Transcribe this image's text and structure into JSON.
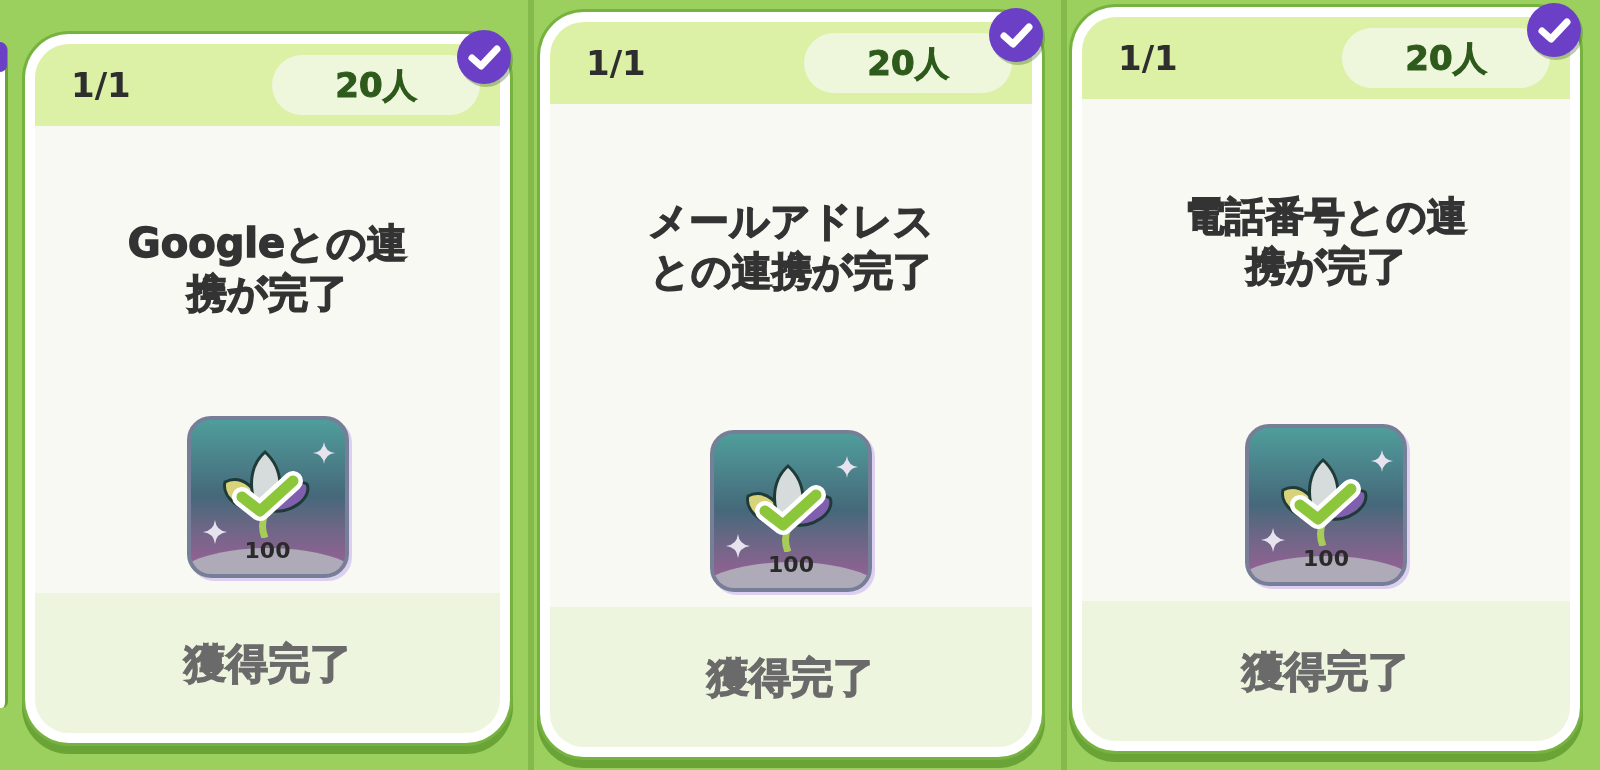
{
  "panels": [
    {
      "partial_card_left": {
        "completed": true
      },
      "card": {
        "progress": "1/1",
        "participants": "20人",
        "completed": true,
        "title_lines": [
          "Googleとの連",
          "携が完了"
        ],
        "reward": {
          "amount": "100",
          "claimed": true
        },
        "claim_button": {
          "label": "獲得完了",
          "disabled": true
        }
      }
    },
    {
      "card": {
        "progress": "1/1",
        "participants": "20人",
        "completed": true,
        "title_lines": [
          "メールアドレス",
          "との連携が完了"
        ],
        "reward": {
          "amount": "100",
          "claimed": true
        },
        "claim_button": {
          "label": "獲得完了",
          "disabled": true
        }
      }
    },
    {
      "card": {
        "progress": "1/1",
        "participants": "20人",
        "completed": true,
        "title_lines": [
          "電話番号との連",
          "携が完了"
        ],
        "reward": {
          "amount": "100",
          "claimed": true
        },
        "claim_button": {
          "label": "獲得完了",
          "disabled": true
        }
      }
    }
  ]
}
